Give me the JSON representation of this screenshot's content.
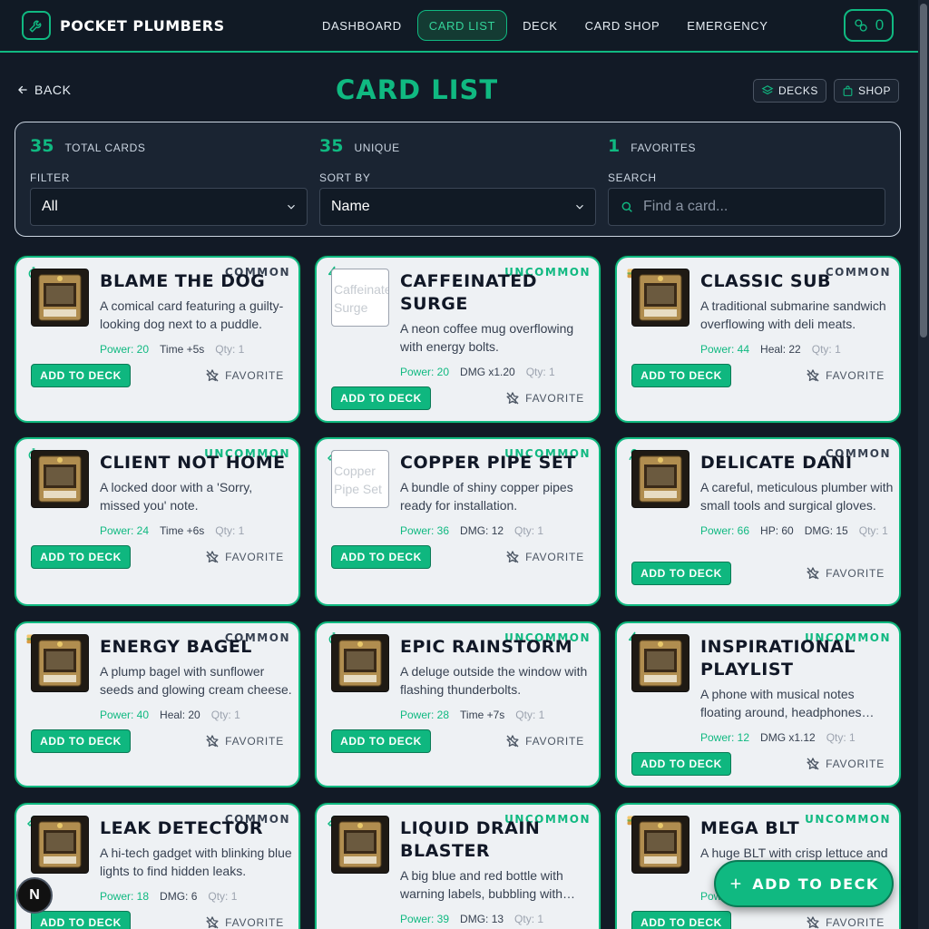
{
  "app": {
    "name": "POCKET PLUMBERS",
    "coins": "0"
  },
  "nav": [
    {
      "label": "DASHBOARD",
      "active": false
    },
    {
      "label": "CARD LIST",
      "active": true
    },
    {
      "label": "DECK",
      "active": false
    },
    {
      "label": "CARD SHOP",
      "active": false
    },
    {
      "label": "EMERGENCY",
      "active": false
    }
  ],
  "header": {
    "back": "BACK",
    "title": "CARD LIST",
    "decks_btn": "DECKS",
    "shop_btn": "SHOP"
  },
  "stats": [
    {
      "num": "35",
      "label": "TOTAL CARDS"
    },
    {
      "num": "35",
      "label": "UNIQUE"
    },
    {
      "num": "1",
      "label": "FAVORITES"
    }
  ],
  "filters": {
    "filter_label": "FILTER",
    "filter_value": "All",
    "sort_label": "SORT BY",
    "sort_value": "Name",
    "search_label": "SEARCH",
    "search_placeholder": "Find a card..."
  },
  "cards": [
    {
      "name": "BLAME THE DOG",
      "rarity": "COMMON",
      "desc": "A comical card featuring a guilty-looking dog next to a puddle.",
      "stats": [
        "Power: 20",
        "Time +5s",
        "Qty: 1"
      ],
      "icon": "timer-icon",
      "img_alt": ""
    },
    {
      "name": "CAFFEINATED SURGE",
      "rarity": "UNCOMMON",
      "desc": "A neon coffee mug overflowing with energy bolts.",
      "stats": [
        "Power: 20",
        "DMG x1.20",
        "Qty: 1"
      ],
      "icon": "bolt-icon",
      "img_alt": "Caffeinated Surge"
    },
    {
      "name": "CLASSIC SUB",
      "rarity": "COMMON",
      "desc": "A traditional submarine sandwich overflowing with deli meats.",
      "stats": [
        "Power: 44",
        "Heal: 22",
        "Qty: 1"
      ],
      "icon": "sandwich-icon",
      "img_alt": ""
    },
    {
      "name": "CLIENT NOT HOME",
      "rarity": "UNCOMMON",
      "desc": "A locked door with a 'Sorry, missed you' note.",
      "stats": [
        "Power: 24",
        "Time +6s",
        "Qty: 1"
      ],
      "icon": "timer-icon",
      "img_alt": ""
    },
    {
      "name": "COPPER PIPE SET",
      "rarity": "UNCOMMON",
      "desc": "A bundle of shiny copper pipes ready for installation.",
      "stats": [
        "Power: 36",
        "DMG: 12",
        "Qty: 1"
      ],
      "icon": "wrench-icon",
      "img_alt": "Copper Pipe Set"
    },
    {
      "name": "DELICATE DANI",
      "rarity": "COMMON",
      "desc": "A careful, meticulous plumber with small tools and surgical gloves.",
      "stats": [
        "Power: 66",
        "HP: 60",
        "DMG: 15",
        "Qty: 1"
      ],
      "icon": "person-icon",
      "img_alt": ""
    },
    {
      "name": "ENERGY BAGEL",
      "rarity": "COMMON",
      "desc": "A plump bagel with sunflower seeds and glowing cream cheese.",
      "stats": [
        "Power: 40",
        "Heal: 20",
        "Qty: 1"
      ],
      "icon": "sandwich-icon",
      "img_alt": ""
    },
    {
      "name": "EPIC RAINSTORM",
      "rarity": "UNCOMMON",
      "desc": "A deluge outside the window with flashing thunderbolts.",
      "stats": [
        "Power: 28",
        "Time +7s",
        "Qty: 1"
      ],
      "icon": "timer-icon",
      "img_alt": ""
    },
    {
      "name": "INSPIRATIONAL PLAYLIST",
      "rarity": "UNCOMMON",
      "desc": "A phone with musical notes floating around, headphones attached.",
      "stats": [
        "Power: 12",
        "DMG x1.12",
        "Qty: 1"
      ],
      "icon": "bolt-icon",
      "img_alt": ""
    },
    {
      "name": "LEAK DETECTOR",
      "rarity": "COMMON",
      "desc": "A hi-tech gadget with blinking blue lights to find hidden leaks.",
      "stats": [
        "Power: 18",
        "DMG: 6",
        "Qty: 1"
      ],
      "icon": "wrench-icon",
      "img_alt": ""
    },
    {
      "name": "LIQUID DRAIN BLASTER",
      "rarity": "UNCOMMON",
      "desc": "A big blue and red bottle with warning labels, bubbling with foam.",
      "stats": [
        "Power: 39",
        "DMG: 13",
        "Qty: 1"
      ],
      "icon": "wrench-icon",
      "img_alt": ""
    },
    {
      "name": "MEGA BLT",
      "rarity": "UNCOMMON",
      "desc": "A huge BLT with crisp lettuce and",
      "stats": [
        "Pow"
      ],
      "icon": "sandwich-icon",
      "img_alt": ""
    }
  ],
  "card_actions": {
    "add": "ADD TO DECK",
    "favorite": "FAVORITE"
  },
  "fab": {
    "label": "ADD TO DECK"
  },
  "badge": {
    "label": "N"
  },
  "colors": {
    "accent": "#10b981",
    "background": "#121a26",
    "card": "#eef1f4"
  }
}
